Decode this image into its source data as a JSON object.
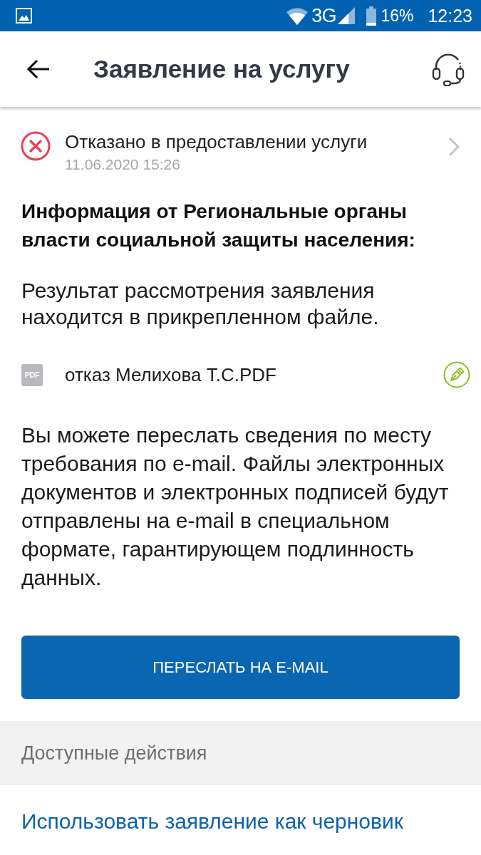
{
  "status_bar": {
    "network": "3G",
    "battery": "16%",
    "time": "12:23"
  },
  "app_bar": {
    "title": "Заявление на услугу"
  },
  "status": {
    "kind": "rejected",
    "title": "Отказано в предоставлении услуги",
    "date": "11.06.2020 15:26"
  },
  "info_heading": "Информация от Региональные органы власти социальной защиты населения:",
  "result_text": "Результат рассмотрения заявления находится в прикрепленном файле.",
  "attachments": [
    {
      "type_label": "PDF",
      "name": "отказ Мелихова Т.С.PDF",
      "signed": true
    }
  ],
  "email_note": "Вы можете переслать сведения по месту требования по e-mail. Файлы электронных документов и электронных подписей будут отправлены на e-mail в специальном формате, гарантирующем подлинность данных.",
  "forward_button": "ПЕРЕСЛАТЬ НА E-MAIL",
  "actions": {
    "title": "Доступные действия",
    "items": [
      "Использовать заявление как черновик"
    ]
  }
}
